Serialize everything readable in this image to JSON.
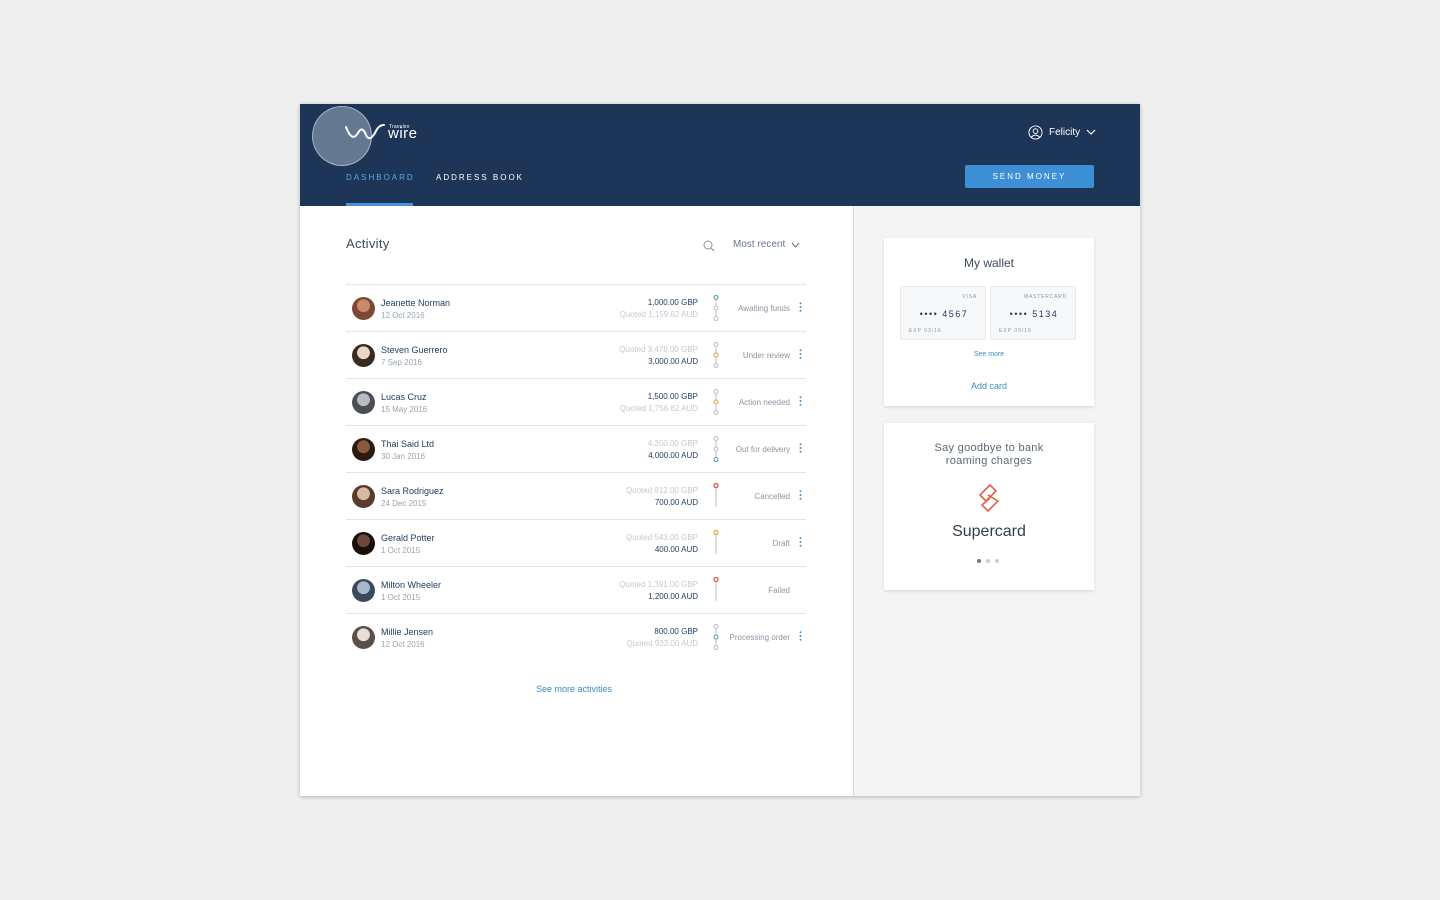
{
  "brand": {
    "tagline": "Travelex",
    "name": "wire"
  },
  "header": {
    "user_name": "Felicity",
    "tabs": [
      {
        "label": "DASHBOARD",
        "active": true
      },
      {
        "label": "ADDRESS BOOK",
        "active": false
      }
    ],
    "send_button": "SEND MONEY"
  },
  "activity": {
    "title": "Activity",
    "sort_label": "Most recent",
    "see_more": "See more activities",
    "rows": [
      {
        "name": "Jeanette Norman",
        "date": "12 Oct 2016",
        "amount_top": "1,000.00 GBP",
        "amount_bottom": "Quoted 1,159.62 AUD",
        "top_dark": true,
        "status": "Awaiting funds",
        "menu": true,
        "stage": 1,
        "color": "#4a9fa8"
      },
      {
        "name": "Steven Guerrero",
        "date": "7 Sep 2016",
        "amount_top": "Quoted 3,478.00 GBP",
        "amount_bottom": "3,000.00 AUD",
        "top_dark": false,
        "status": "Under review",
        "menu": true,
        "stage": 2,
        "color": "#e8a33d"
      },
      {
        "name": "Lucas Cruz",
        "date": "15 May 2016",
        "amount_top": "1,500.00 GBP",
        "amount_bottom": "Quoted 1,756.62 AUD",
        "top_dark": true,
        "status": "Action needed",
        "menu": true,
        "stage": 2,
        "color": "#e8a33d"
      },
      {
        "name": "Thai Said Ltd",
        "date": "30 Jan 2016",
        "amount_top": "4,350.00 GBP",
        "amount_bottom": "4,000.00 AUD",
        "top_dark": false,
        "status": "Out for delivery",
        "menu": true,
        "stage": 3,
        "color": "#4a9fa8"
      },
      {
        "name": "Sara Rodriguez",
        "date": "24 Dec 2015",
        "amount_top": "Quoted 812.00 GBP",
        "amount_bottom": "700.00 AUD",
        "top_dark": false,
        "status": "Cancelled",
        "menu": true,
        "stage": 0,
        "color": "#d9534f"
      },
      {
        "name": "Gerald Potter",
        "date": "1 Oct 2015",
        "amount_top": "Quoted 543.00 GBP",
        "amount_bottom": "400.00 AUD",
        "top_dark": false,
        "status": "Draft",
        "menu": true,
        "stage": 0,
        "color": "#e8a33d"
      },
      {
        "name": "Milton Wheeler",
        "date": "1 Oct 2015",
        "amount_top": "Quoted 1,391.00 GBP",
        "amount_bottom": "1,200.00 AUD",
        "top_dark": false,
        "status": "Failed",
        "menu": false,
        "stage": 0,
        "color": "#d9534f"
      },
      {
        "name": "Millie Jensen",
        "date": "12 Oct 2016",
        "amount_top": "800.00 GBP",
        "amount_bottom": "Quoted 933.00 AUD",
        "top_dark": true,
        "status": "Processing order",
        "menu": true,
        "stage": 2,
        "color": "#4a9fa8"
      }
    ]
  },
  "wallet": {
    "title": "My wallet",
    "cards": [
      {
        "brand": "VISA",
        "number": "•••• 4567",
        "exp": "EXP 03/16"
      },
      {
        "brand": "MASTERCARD",
        "number": "•••• 5134",
        "exp": "EXP 09/16"
      }
    ],
    "see_more": "See more",
    "add_card": "Add card"
  },
  "promo": {
    "text": "Say goodbye to bank roaming charges",
    "brand": "Supercard",
    "slides": 3,
    "active_slide": 0
  },
  "colors": {
    "header_bg": "#1d3557",
    "accent": "#3d8fd6",
    "link": "#3a8bb8",
    "promo_icon": "#e0614a"
  }
}
